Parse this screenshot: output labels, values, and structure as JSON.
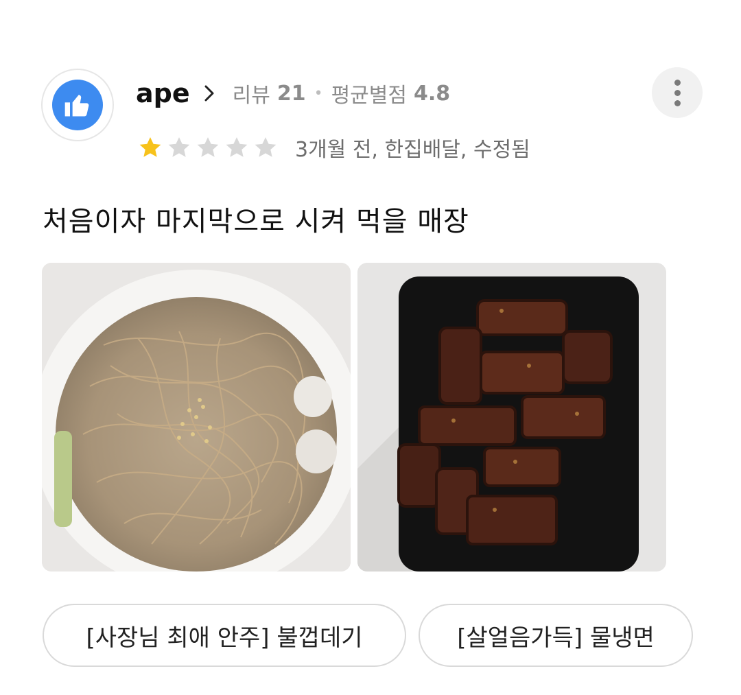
{
  "reviewer": {
    "avatar_icon": "thumbs-up-icon",
    "avatar_color": "#3d8bf0",
    "name": "ape",
    "review_count_label": "리뷰",
    "review_count": "21",
    "avg_rating_label": "평균별점",
    "avg_rating": "4.8"
  },
  "rating": {
    "stars": 1,
    "max_stars": 5,
    "filled_color": "#f7c21b",
    "empty_color": "#d7d7d7",
    "meta": "3개월 전, 한집배달, 수정됨"
  },
  "review": {
    "text": "처음이자 마지막으로 시켜 먹을 매장"
  },
  "photos": [
    {
      "subject": "naengmyeon-photo"
    },
    {
      "subject": "bulkkeopdegi-photo"
    }
  ],
  "menu_items": [
    "[사장님 최애 안주] 불껍데기",
    "[살얼음가득] 물냉면"
  ]
}
